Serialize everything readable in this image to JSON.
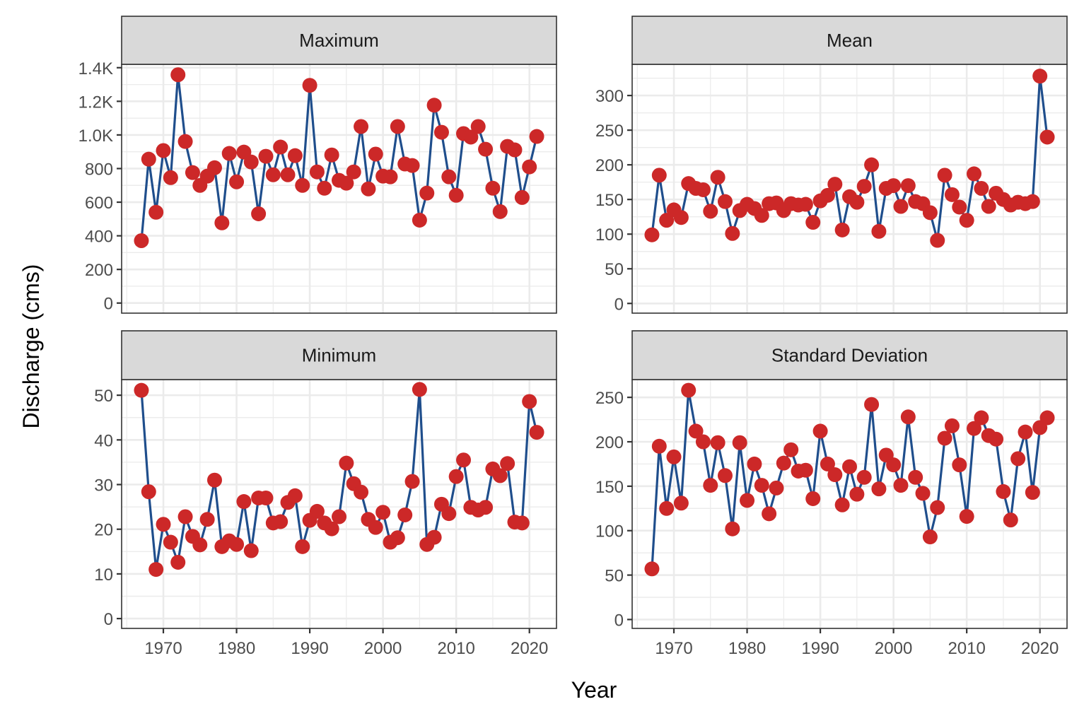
{
  "chart_data": {
    "type": "line",
    "layout": "facet-2x2",
    "xlabel": "Year",
    "ylabel": "Discharge (cms)",
    "x_ticks": [
      1970,
      1980,
      1990,
      2000,
      2010,
      2020
    ],
    "xlim": [
      1964.3,
      2023.7
    ],
    "grid": true,
    "line_color": "#1f4e8c",
    "point_color": "#cc2828",
    "x": [
      1967,
      1968,
      1969,
      1970,
      1971,
      1972,
      1973,
      1974,
      1975,
      1976,
      1977,
      1978,
      1979,
      1980,
      1981,
      1982,
      1983,
      1984,
      1985,
      1986,
      1987,
      1988,
      1989,
      1990,
      1991,
      1992,
      1993,
      1994,
      1995,
      1996,
      1997,
      1998,
      1999,
      2000,
      2001,
      2002,
      2003,
      2004,
      2005,
      2006,
      2007,
      2008,
      2009,
      2010,
      2011,
      2012,
      2013,
      2014,
      2015,
      2016,
      2017,
      2018,
      2019,
      2020,
      2021
    ],
    "panels": [
      {
        "title": "Maximum",
        "ylim": [
          -60,
          1420
        ],
        "y_ticks": [
          0,
          200,
          400,
          600,
          800,
          1000,
          1200,
          1400
        ],
        "y_tick_labels": [
          "0",
          "200",
          "400",
          "600",
          "800",
          "1.0K",
          "1.2K",
          "1.4K"
        ],
        "values": [
          371,
          856,
          540,
          907,
          746,
          1358,
          961,
          776,
          700,
          755,
          805,
          477,
          890,
          721,
          898,
          839,
          531,
          873,
          763,
          928,
          763,
          877,
          700,
          1295,
          780,
          683,
          881,
          730,
          713,
          780,
          1050,
          679,
          886,
          755,
          751,
          1050,
          827,
          818,
          493,
          654,
          1177,
          1016,
          751,
          641,
          1008,
          987,
          1050,
          915,
          683,
          544,
          932,
          911,
          628,
          810,
          991
        ]
      },
      {
        "title": "Mean",
        "ylim": [
          -14,
          345
        ],
        "y_ticks": [
          0,
          50,
          100,
          150,
          200,
          250,
          300
        ],
        "y_tick_labels": [
          "0",
          "50",
          "100",
          "150",
          "200",
          "250",
          "300"
        ],
        "values": [
          99,
          185,
          120,
          135,
          124,
          173,
          166,
          164,
          133,
          182,
          147,
          101,
          134,
          143,
          137,
          127,
          144,
          145,
          134,
          144,
          142,
          143,
          117,
          148,
          156,
          172,
          106,
          154,
          146,
          169,
          200,
          104,
          166,
          170,
          140,
          170,
          147,
          144,
          131,
          91,
          185,
          157,
          139,
          120,
          187,
          166,
          140,
          159,
          150,
          142,
          146,
          144,
          147,
          328,
          240
        ]
      },
      {
        "title": "Minimum",
        "ylim": [
          -2.2,
          53.5
        ],
        "y_ticks": [
          0,
          10,
          20,
          30,
          40,
          50
        ],
        "y_tick_labels": [
          "0",
          "10",
          "20",
          "30",
          "40",
          "50"
        ],
        "values": [
          51.1,
          28.4,
          11.0,
          21.1,
          17.1,
          12.6,
          22.8,
          18.4,
          16.5,
          22.2,
          31.0,
          16.1,
          17.4,
          16.6,
          26.2,
          15.2,
          27.0,
          27.0,
          21.4,
          21.7,
          26.0,
          27.5,
          16.1,
          22.0,
          24.0,
          21.4,
          20.1,
          22.8,
          34.8,
          30.2,
          28.3,
          22.2,
          20.4,
          23.8,
          17.1,
          18.1,
          23.2,
          30.7,
          51.3,
          16.6,
          18.2,
          25.6,
          23.5,
          31.8,
          35.5,
          24.9,
          24.3,
          24.9,
          33.5,
          32.0,
          34.7,
          21.6,
          21.4,
          48.6,
          41.7
        ]
      },
      {
        "title": "Standard Deviation",
        "ylim": [
          -10,
          270
        ],
        "y_ticks": [
          0,
          50,
          100,
          150,
          200,
          250
        ],
        "y_tick_labels": [
          "0",
          "50",
          "100",
          "150",
          "200",
          "250"
        ],
        "values": [
          57,
          195,
          125,
          183,
          131,
          258,
          212,
          200,
          151,
          199,
          162,
          102,
          199,
          134,
          175,
          151,
          119,
          148,
          176,
          191,
          167,
          168,
          136,
          212,
          175,
          163,
          129,
          172,
          141,
          160,
          242,
          147,
          185,
          174,
          151,
          228,
          160,
          142,
          93,
          126,
          204,
          218,
          174,
          116,
          215,
          227,
          207,
          203,
          144,
          112,
          181,
          211,
          143,
          216,
          227
        ]
      }
    ]
  }
}
